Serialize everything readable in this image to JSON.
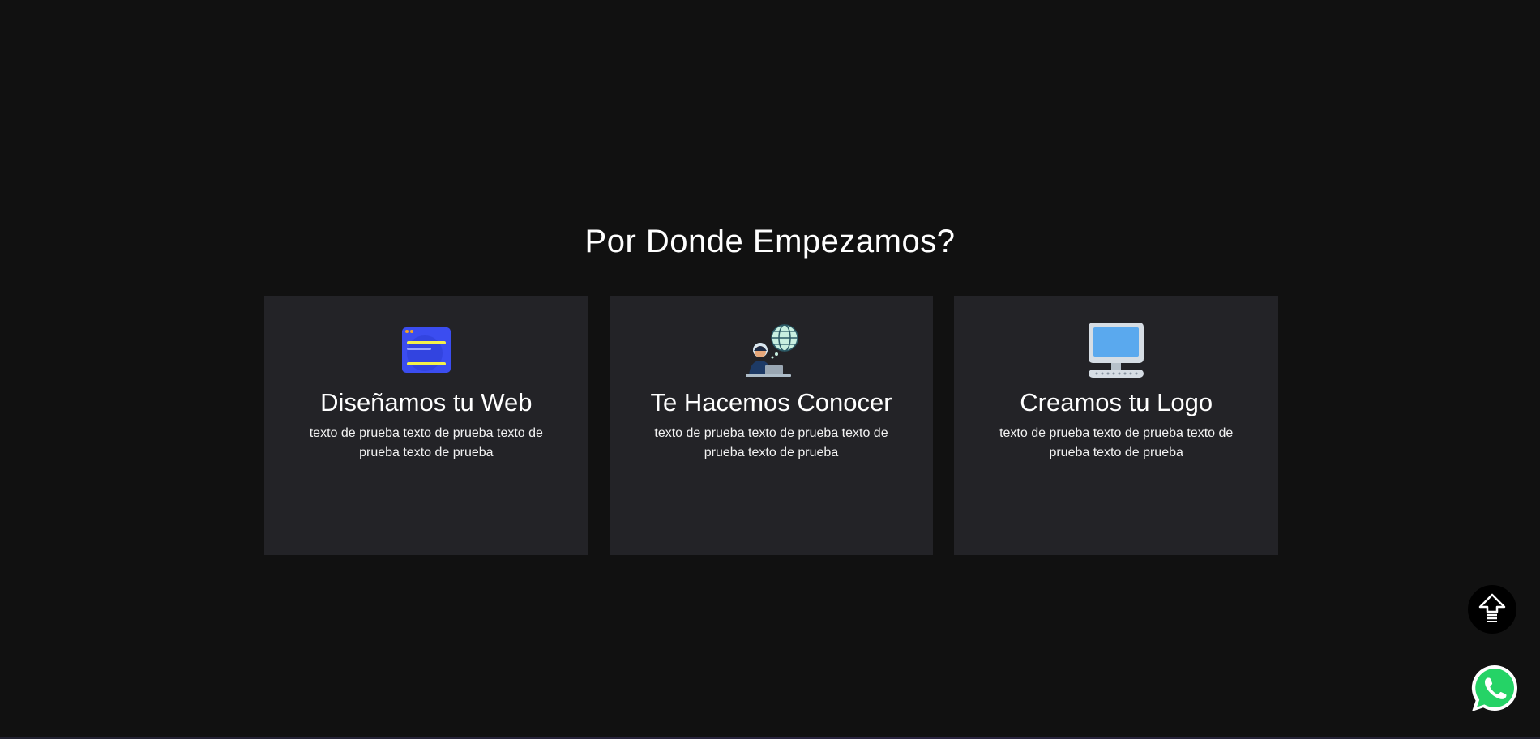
{
  "section": {
    "title": "Por Donde Empezamos?"
  },
  "cards": [
    {
      "icon": "web-design-icon",
      "title": "Diseñamos tu Web",
      "text": "texto de prueba texto de prueba texto de prueba texto de prueba"
    },
    {
      "icon": "marketing-person-globe-icon",
      "title": "Te Hacemos Conocer",
      "text": "texto de prueba texto de prueba texto de prueba texto de prueba"
    },
    {
      "icon": "computer-monitor-icon",
      "title": "Creamos tu Logo",
      "text": "texto de prueba texto de prueba texto de prueba texto de prueba"
    }
  ],
  "floating": {
    "scroll_top_icon": "arrow-up-icon",
    "whatsapp_icon": "whatsapp-icon"
  },
  "colors": {
    "background": "#111111",
    "card": "#232327",
    "whatsapp_green": "#25D366"
  }
}
